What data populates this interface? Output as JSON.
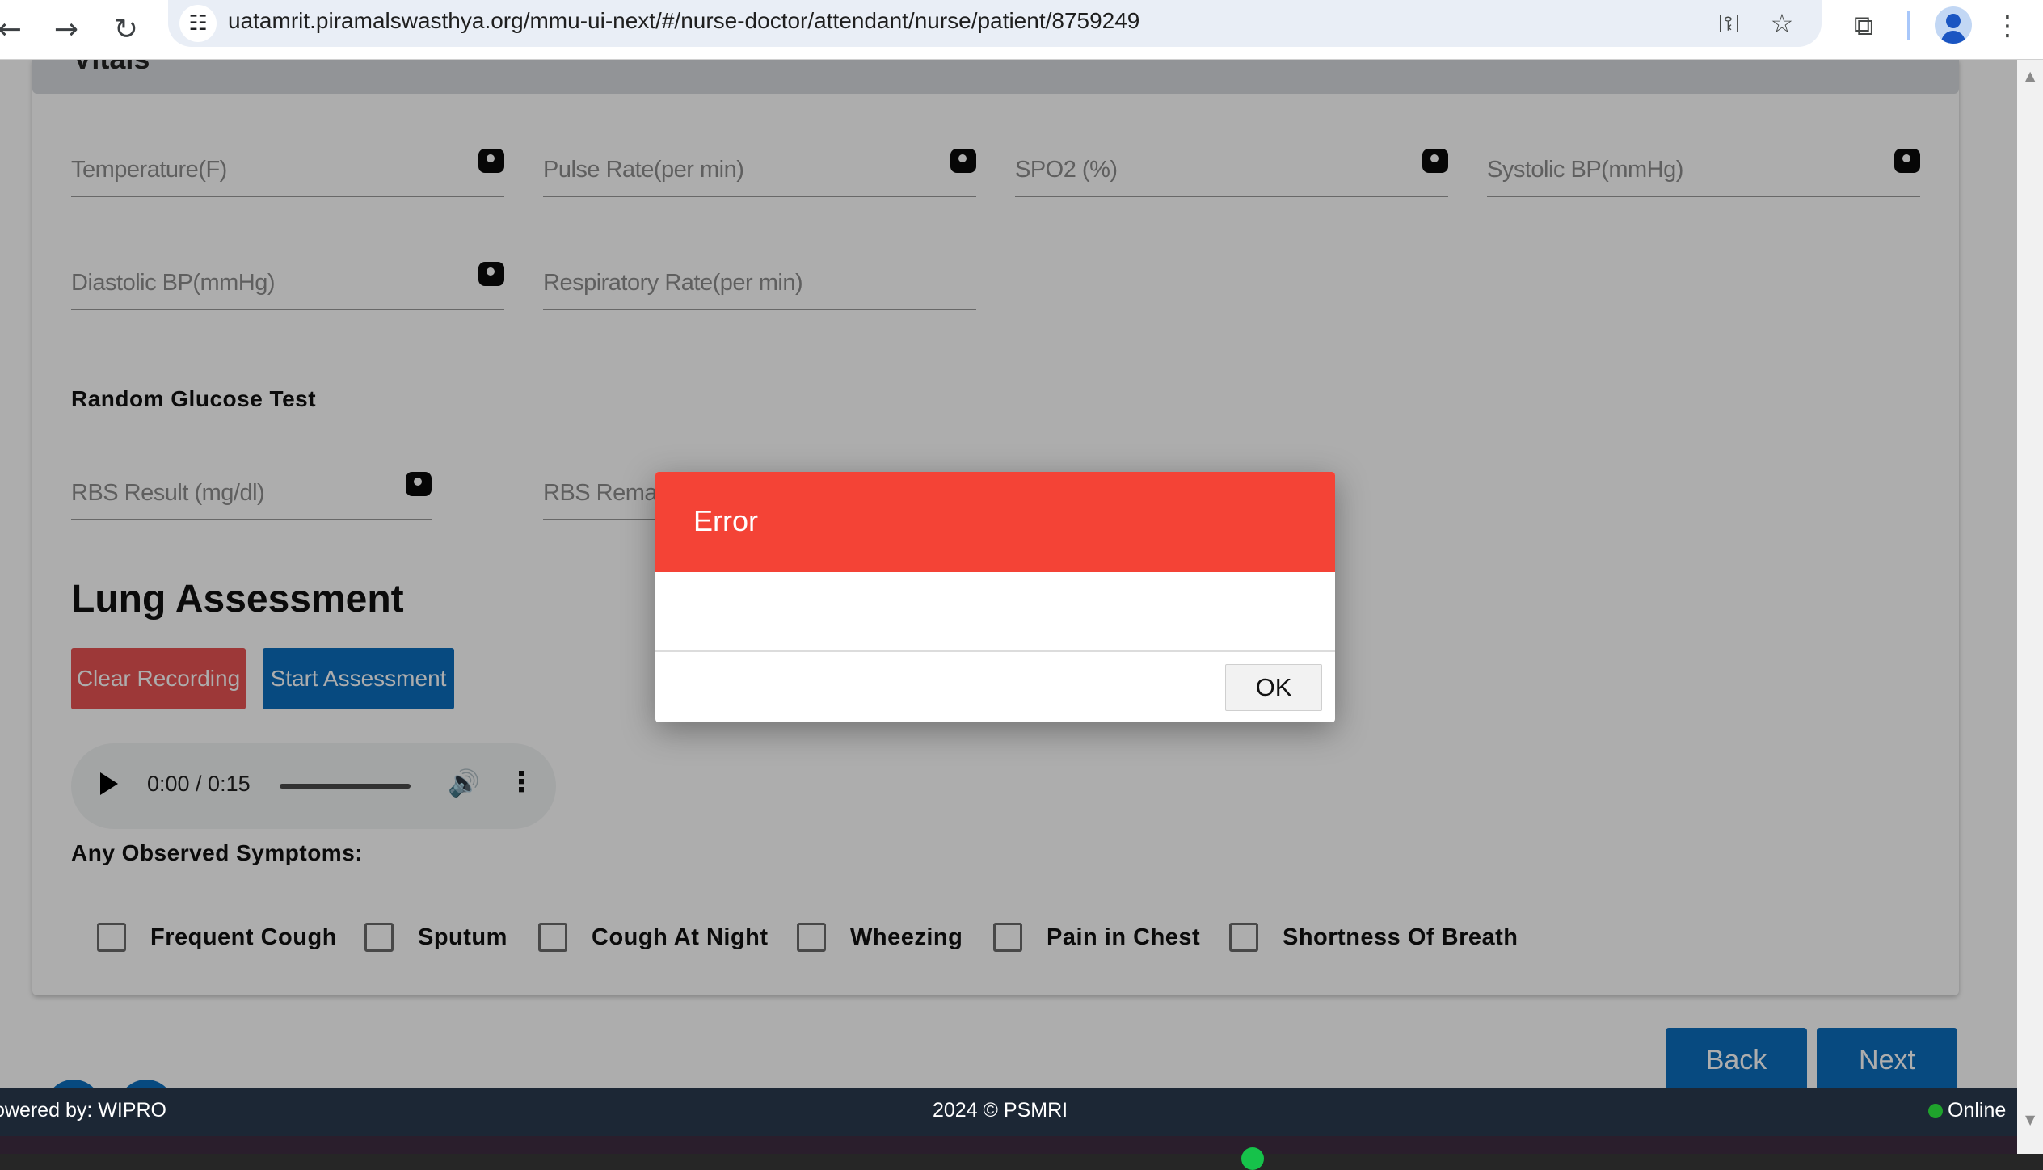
{
  "browser": {
    "url": "uatamrit.piramalswasthya.org/mmu-ui-next/#/nurse-doctor/attendant/nurse/patient/8759249"
  },
  "vitals": {
    "section_title": "Vitals",
    "fields": {
      "temperature": "Temperature(F)",
      "pulse_rate": "Pulse Rate(per min)",
      "spo2": "SPO2 (%)",
      "systolic_bp": "Systolic BP(mmHg)",
      "diastolic_bp": "Diastolic BP(mmHg)",
      "respiratory_rate": "Respiratory Rate(per min)"
    }
  },
  "glucose": {
    "title": "Random Glucose Test",
    "rbs_result": "RBS Result (mg/dl)",
    "rbs_remarks": "RBS Remarks"
  },
  "lung": {
    "title": "Lung Assessment",
    "clear_label": "Clear Recording",
    "start_label": "Start Assessment",
    "audio_time": "0:00 / 0:15",
    "symptoms_label": "Any Observed Symptoms:",
    "symptoms": [
      "Frequent Cough",
      "Sputum",
      "Cough At Night",
      "Wheezing",
      "Pain in Chest",
      "Shortness Of Breath"
    ]
  },
  "navigation": {
    "back_label": "Back",
    "next_label": "Next"
  },
  "footer": {
    "powered_by": "owered by: WIPRO",
    "copyright": "2024 © PSMRI",
    "status": "Online"
  },
  "dialog": {
    "title": "Error",
    "message": "",
    "ok_label": "OK"
  },
  "colors": {
    "dialog_header": "#f44336",
    "primary_button": "#0b6dbd",
    "danger_button": "#e85353",
    "footer_bg": "#1c2735",
    "online_dot": "#1fa32c"
  }
}
